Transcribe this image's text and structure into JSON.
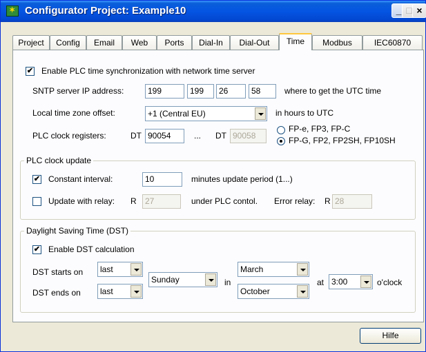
{
  "window": {
    "title": "Configurator Project: Example10",
    "app_icon": "configurator-app-icon",
    "controls": {
      "minimize": "_",
      "maximize": "□",
      "close": "×"
    }
  },
  "tabs": [
    {
      "label": "Project"
    },
    {
      "label": "Config"
    },
    {
      "label": "Email"
    },
    {
      "label": "Web"
    },
    {
      "label": "Ports"
    },
    {
      "label": "Dial-In"
    },
    {
      "label": "Dial-Out"
    },
    {
      "label": "Time"
    },
    {
      "label": "Modbus"
    },
    {
      "label": "IEC60870"
    }
  ],
  "active_tab": "Time",
  "sync": {
    "enable_label": "Enable PLC time synchronization with network time server",
    "enable_checked": true,
    "sntp_label": "SNTP server IP address:",
    "ip": [
      "199",
      "199",
      "26",
      "58"
    ],
    "ip_hint": "where to get the UTC time",
    "tz_label": "Local time zone offset:",
    "tz_value": "+1  (Central EU)",
    "tz_hint": "in hours to UTC",
    "reg_label": "PLC clock registers:",
    "dt_prefix": "DT",
    "reg_from": "90054",
    "ellipsis": "...",
    "reg_to": "90058",
    "radio_a": "FP-e, FP3, FP-C",
    "radio_b": "FP-G, FP2, FP2SH, FP10SH",
    "selected_radio": "b"
  },
  "clock_update": {
    "title": "PLC clock update",
    "constant_label": "Constant interval:",
    "constant_checked": true,
    "interval": "10",
    "interval_hint": "minutes update period (1...)",
    "relay_label": "Update with relay:",
    "relay_checked": false,
    "r_prefix": "R",
    "relay_value": "27",
    "relay_hint": "under PLC contol.",
    "error_label": "Error relay:",
    "error_value": "28"
  },
  "dst": {
    "title": "Daylight Saving Time (DST)",
    "enable_label": "Enable DST calculation",
    "enable_checked": true,
    "starts_label": "DST starts on",
    "starts_week": "last",
    "ends_label": "DST ends on",
    "ends_week": "last",
    "weekday": "Sunday",
    "in_label": "in",
    "start_month": "March",
    "end_month": "October",
    "at_label": "at",
    "time": "3:00",
    "oclock_label": "o'clock"
  },
  "footer": {
    "help_label": "Hilfe"
  },
  "check_mark": "✔"
}
